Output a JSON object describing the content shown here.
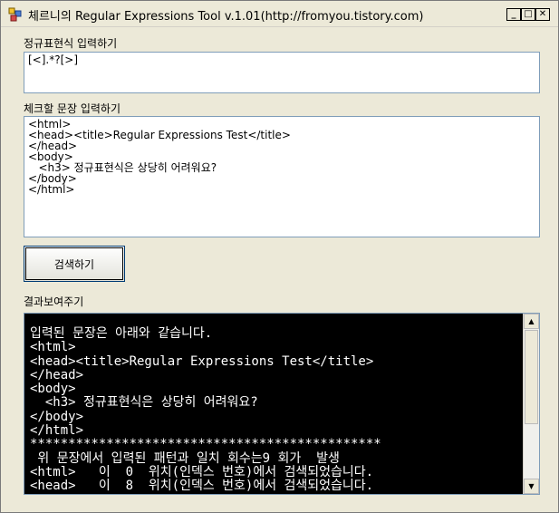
{
  "window": {
    "title": "체르니의 Regular Expressions Tool v.1.01(http://fromyou.tistory.com)",
    "min_label": "_",
    "max_label": "□",
    "close_label": "✕"
  },
  "regex_section": {
    "label": "정규표현식 입력하기",
    "value": "[<].*?[>]"
  },
  "text_section": {
    "label": "체크할 문장 입력하기",
    "lines": [
      "<html>",
      "<head><title>Regular Expressions Test</title>",
      "</head>",
      "<body>",
      "   <h3> 정규표현식은 상당히 어려워요?",
      "</body>",
      "</html>"
    ]
  },
  "search_button": {
    "label": "검색하기"
  },
  "result_section": {
    "label": "결과보여주기",
    "lines": [
      "입력된 문장은 아래와 같습니다.",
      "<html>",
      "<head><title>Regular Expressions Test</title>",
      "</head>",
      "<body>",
      "  <h3> 정규표현식은 상당히 어려워요?",
      "</body>",
      "</html>",
      "**********************************************",
      " 위 문장에서 입력된 패턴과 일치 회수는9 회가  발생",
      "<html>   이  0  위치(인덱스 번호)에서 검색되었습니다.",
      "<head>   이  8  위치(인덱스 번호)에서 검색되었습니다."
    ]
  },
  "scrollbar": {
    "up": "▲",
    "down": "▼"
  }
}
